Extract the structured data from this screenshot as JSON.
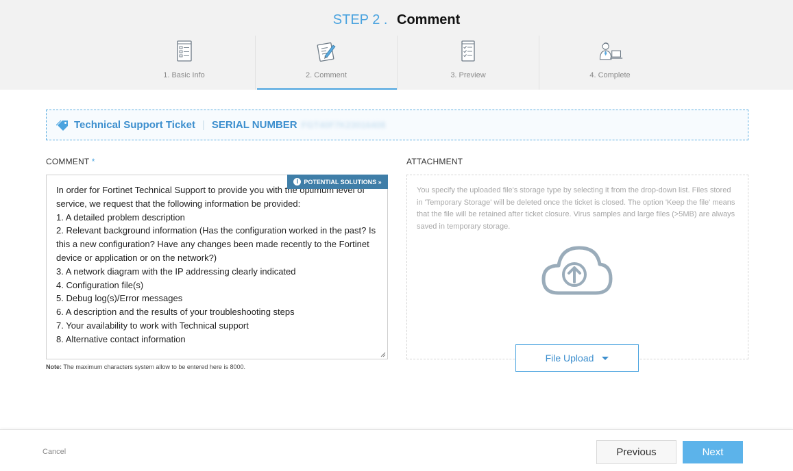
{
  "header": {
    "step_prefix": "STEP 2 .",
    "step_name": "Comment",
    "steps": [
      {
        "label": "1. Basic Info",
        "icon": "form-document-icon"
      },
      {
        "label": "2. Comment",
        "icon": "edit-note-icon"
      },
      {
        "label": "3. Preview",
        "icon": "checklist-icon"
      },
      {
        "label": "4. Complete",
        "icon": "person-at-laptop-icon"
      }
    ],
    "active_step": 2
  },
  "ticket": {
    "type_label": "Technical Support Ticket",
    "serial_label": "SERIAL NUMBER",
    "serial_value": "FGT40F7K23016408"
  },
  "comment": {
    "label": "COMMENT",
    "required_mark": "*",
    "potential_solutions": "POTENTIAL SOLUTIONS »",
    "lines": [
      "In order for Fortinet Technical Support to provide you with the optimum level of service, we request that the following information be provided:",
      "1. A detailed problem description",
      "2. Relevant background information (Has the configuration worked in the past? Is this a new configuration? Have any changes been made recently to the Fortinet device or application or on the network?)",
      "3. A network diagram with the IP addressing clearly indicated",
      "4. Configuration file(s)",
      "5. Debug log(s)/Error messages",
      "6. A description and the results of your troubleshooting steps",
      "7. Your availability to work with Technical support",
      "8. Alternative contact information"
    ],
    "note_label": "Note:",
    "note_text": "The maximum characters system allow to be entered here is 8000."
  },
  "attachment": {
    "label": "ATTACHMENT",
    "help_text": "You specify the uploaded file's storage type by selecting it from the drop-down list. Files stored in 'Temporary Storage' will be deleted once the ticket is closed. The option 'Keep the file' means that the file will be retained after ticket closure. Virus samples and large files (>5MB) are always saved in temporary storage.",
    "upload_label": "File Upload"
  },
  "footer": {
    "cancel": "Cancel",
    "previous": "Previous",
    "next": "Next"
  },
  "colors": {
    "accent": "#4aa3df",
    "next_button": "#5cb3ea",
    "potential_button": "#3f7ea8",
    "cloud_icon": "#9aacba"
  }
}
